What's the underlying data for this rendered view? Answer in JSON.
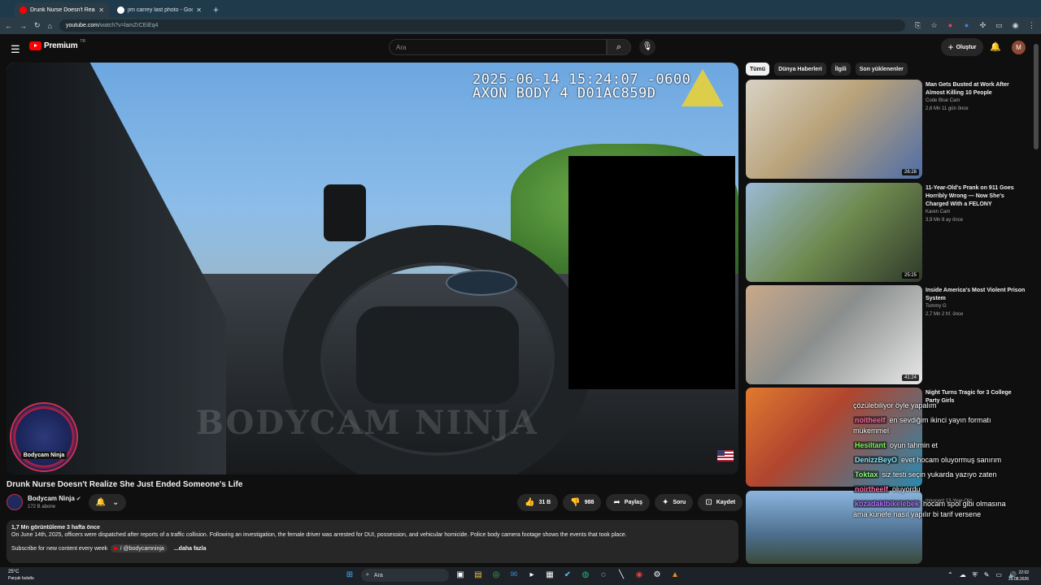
{
  "browser": {
    "tabs": [
      {
        "title": "Drunk Nurse Doesn't Realize Sh",
        "active": true
      },
      {
        "title": "jim carrey last photo - Google S",
        "active": false
      }
    ],
    "url_host": "youtube.com",
    "url_path": "/watch?v=lamZrCEiEq4"
  },
  "header": {
    "logo": "Premium",
    "logo_sup": "TR",
    "search_placeholder": "Ara",
    "create_label": "Oluştur",
    "avatar_letter": "M"
  },
  "video": {
    "stamp_line1": "2025-06-14 15:24:07 -0600",
    "stamp_line2": "AXON BODY 4 D01AC859D",
    "watermark": "BODYCAM NINJA",
    "logo_text": "Bodycam Ninja",
    "title": "Drunk Nurse Doesn't Realize She Just Ended Someone's Life"
  },
  "channel": {
    "name": "Bodycam Ninja",
    "subs": "172 B abone"
  },
  "actions": {
    "likes": "31 B",
    "dislikes": "988",
    "share": "Paylaş",
    "ask": "Soru",
    "save": "Kaydet"
  },
  "description": {
    "meta": "1,7 Mn görüntüleme  3 hafta önce",
    "body": "On June 14th, 2025, officers were dispatched after reports of a traffic collision.  Following an investigation, the female driver was arrested for DUI, possession, and vehicular homicide.  Police body camera footage shows the events that took place.",
    "subscribe": "Subscribe for new content every week",
    "mention": "/ @bodycamninja",
    "more": "...daha fazla"
  },
  "chips": [
    "Tümü",
    "Dünya Haberleri",
    "İlgili",
    "Son yüklenenler"
  ],
  "recommended": [
    {
      "title": "Man Gets Busted at Work After Almost Killing 10 People",
      "channel": "Code Blue Cam",
      "meta": "2,6 Mn  11 gün önce",
      "duration": "26:28",
      "thumb_color": "#b9a27a"
    },
    {
      "title": "11-Year-Old's Prank on 911 Goes Horribly Wrong — Now She's Charged With a FELONY",
      "channel": "Karen Cam",
      "meta": "3,9 Mn  8 ay önce",
      "duration": "25:25",
      "thumb_color": "#6f8a4f"
    },
    {
      "title": "Inside America's Most Violent Prison System",
      "channel": "Tommy G",
      "meta": "2,7 Mn  2 hf. önce",
      "duration": "41:24",
      "thumb_color": "#8a8e8c"
    },
    {
      "title": "Night Turns Tragic for 3 College Party Girls",
      "channel": "",
      "meta": "",
      "duration": "",
      "thumb_color": "#b0452f"
    },
    {
      "title": "",
      "channel": "Innocent 13-Year-Old",
      "meta": "",
      "duration": "",
      "thumb_color": "#4d6f8e"
    }
  ],
  "chat": [
    {
      "user": "",
      "text": "çözülebiliyor öyle yapalım",
      "color": "#ffffff",
      "bg": "transparent"
    },
    {
      "user": "noitheelf",
      "text": "en sevdiğim ikinci yayın formatı mükemmel",
      "color": "#ff6fa8",
      "bg": "rgba(0,0,0,0.35)"
    },
    {
      "user": "Hesiltant",
      "text": "oyun tahmin et",
      "color": "#7dff5a",
      "bg": "rgba(0,0,0,0.35)"
    },
    {
      "user": "DenizzBeyO",
      "text": "evet hocam oluyormuş sanırım",
      "color": "#7de9ff",
      "bg": "rgba(0,0,0,0.35)"
    },
    {
      "user": "Toktax",
      "text": "siz testi seçin yukarda yazıyo zaten",
      "color": "#8dff7a",
      "bg": "rgba(0,0,0,0.35)"
    },
    {
      "user": "noirtheelf",
      "text": "oluyordu",
      "color": "#ff6fa8",
      "bg": "rgba(0,0,0,0.35)"
    },
    {
      "user": "kozadaklbikelebek",
      "text": "hocam spoi gibi olmasına ama künefe nasıl yapılır bi tarif versene",
      "color": "#b06fff",
      "bg": "rgba(0,0,0,0.35)"
    }
  ],
  "taskbar": {
    "temp": "25°C",
    "weather": "Parçalı bulutlu",
    "search": "Ara",
    "time": "22:02",
    "date": "29.08.2026"
  },
  "colors": {
    "accent": "#ff0000",
    "bg": "#0f0f0f",
    "chip_active": "#f1f1f1"
  }
}
